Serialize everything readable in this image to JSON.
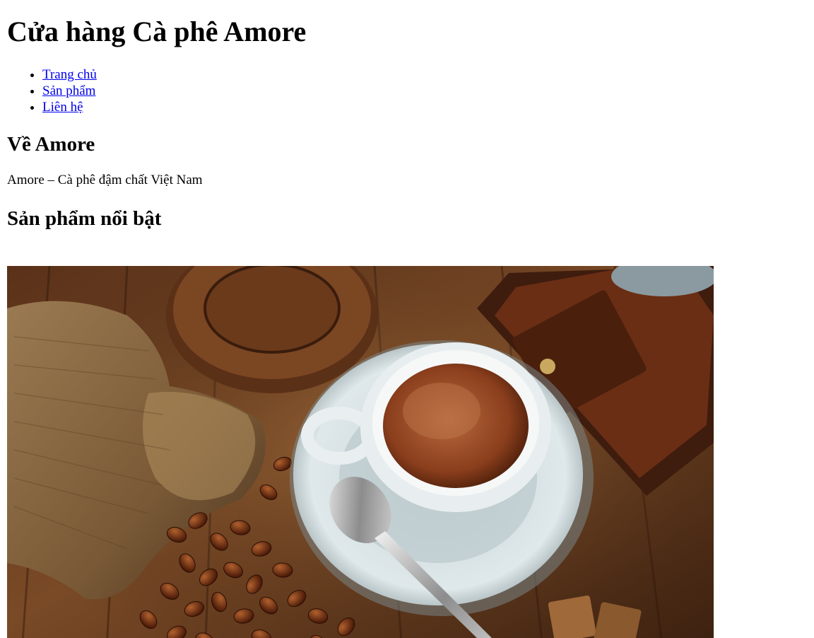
{
  "header": {
    "title": "Cửa hàng Cà phê Amore"
  },
  "nav": {
    "items": [
      {
        "label": "Trang chủ"
      },
      {
        "label": "Sản phẩm"
      },
      {
        "label": "Liên hệ"
      }
    ]
  },
  "about": {
    "heading": "Về Amore",
    "tagline": "Amore – Cà phê đậm chất Việt Nam"
  },
  "featured": {
    "heading": "Sản phẩm nổi bật",
    "image_alt": "coffee-cup-beans-grinder-photo"
  },
  "colors": {
    "link": "#0000ee",
    "text": "#000000",
    "background": "#ffffff"
  }
}
